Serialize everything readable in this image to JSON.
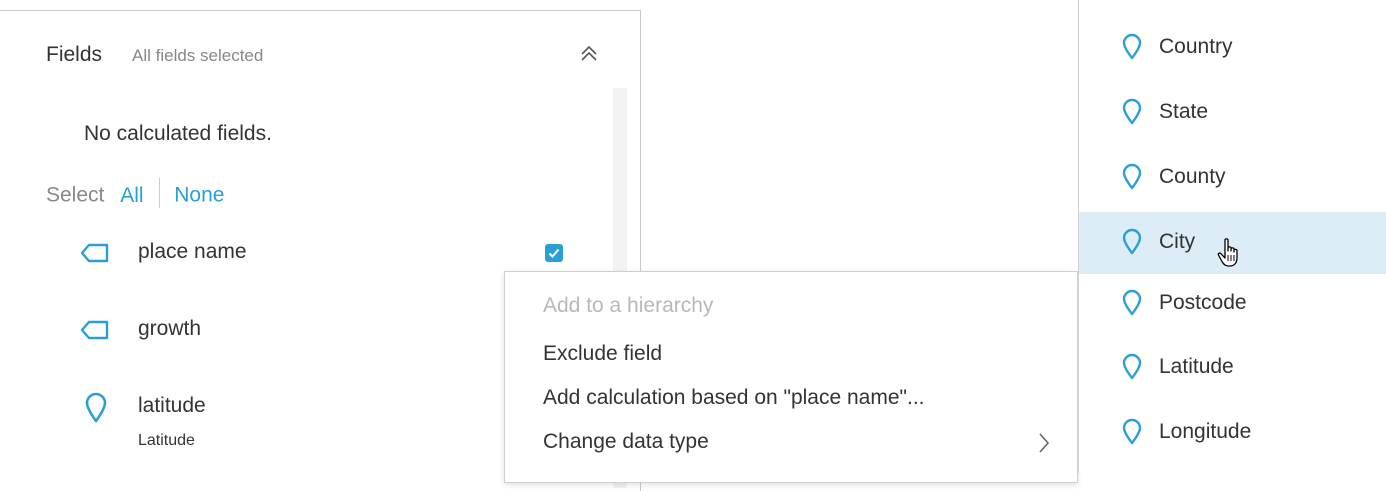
{
  "fields_panel": {
    "title": "Fields",
    "subtitle": "All fields selected",
    "collapse_icon": "double-chevron-up-icon",
    "calculated_empty": "No calculated fields.",
    "select": {
      "label": "Select",
      "all": "All",
      "none": "None"
    },
    "fields": [
      {
        "name": "place name",
        "icon": "tag-icon",
        "checked": true
      },
      {
        "name": "growth",
        "icon": "tag-icon"
      },
      {
        "name": "latitude",
        "icon": "location-pin-icon",
        "sublabel": "Latitude"
      }
    ]
  },
  "context_menu": {
    "items": [
      {
        "label": "Add to a hierarchy",
        "disabled": true
      },
      {
        "label": "Exclude field"
      },
      {
        "label": "Add calculation based on \"place name\"..."
      },
      {
        "label": "Change data type",
        "submenu_icon": "chevron-right-icon"
      }
    ]
  },
  "type_submenu": {
    "items": [
      {
        "label": "Country",
        "icon": "location-pin-icon"
      },
      {
        "label": "State",
        "icon": "location-pin-icon"
      },
      {
        "label": "County",
        "icon": "location-pin-icon"
      },
      {
        "label": "City",
        "icon": "location-pin-icon",
        "highlighted": true
      },
      {
        "label": "Postcode",
        "icon": "location-pin-icon"
      },
      {
        "label": "Latitude",
        "icon": "location-pin-icon"
      },
      {
        "label": "Longitude",
        "icon": "location-pin-icon"
      }
    ]
  },
  "colors": {
    "accent": "#2a9fd6",
    "highlight": "#dcedf8",
    "muted_text": "#888888",
    "disabled_text": "#b8b8b8"
  }
}
